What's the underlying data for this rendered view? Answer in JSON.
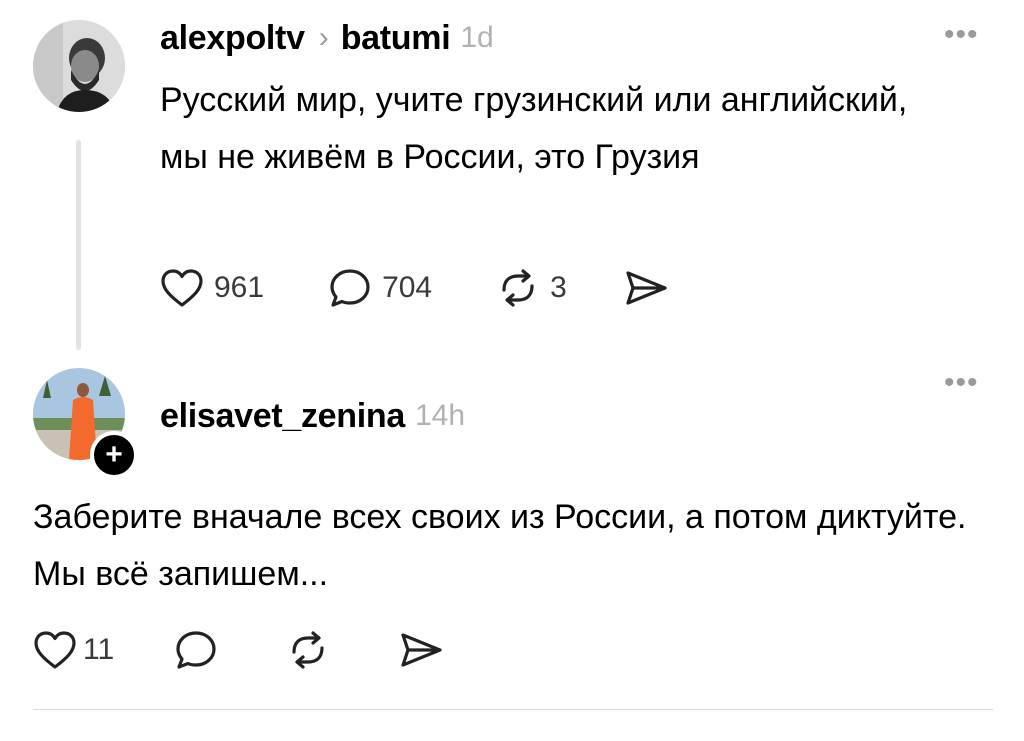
{
  "post": {
    "username": "alexpoltv",
    "separator": "›",
    "topic": "batumi",
    "time": "1d",
    "text": "Русский мир, учите грузинский или английский, мы не живём в России, это Грузия",
    "likes": "961",
    "comments": "704",
    "reposts": "3",
    "more": "•••"
  },
  "reply": {
    "username": "elisavet_zenina",
    "time": "14h",
    "text": "Заберите вначале всех  своих из России, а потом диктуйте. Мы всё запишем...",
    "likes": "11",
    "follow_badge": "+",
    "more": "•••"
  },
  "icons": {
    "like": "heart-icon",
    "comment": "comment-bubble-icon",
    "repost": "repost-arrows-icon",
    "share": "send-icon"
  }
}
